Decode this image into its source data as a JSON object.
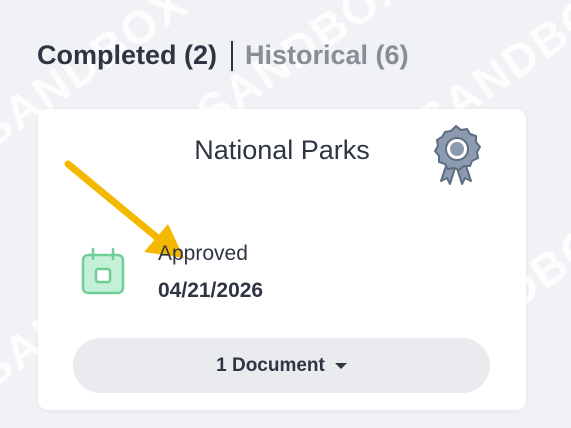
{
  "tabs": {
    "completed": "Completed (2)",
    "historical": "Historical (6)"
  },
  "card": {
    "title": "National Parks",
    "status_label": "Approved",
    "status_date": "04/21/2026",
    "documents_button": "1 Document"
  },
  "watermark_text": "SANDBOX",
  "colors": {
    "background": "#f1f2f6",
    "text": "#2f3542",
    "muted": "#868e96",
    "arrow": "#f5b800",
    "calendar": "#7ed6a8",
    "award": "#8c9bb0"
  },
  "icons": [
    "award-icon",
    "calendar-icon",
    "caret-down-icon"
  ]
}
